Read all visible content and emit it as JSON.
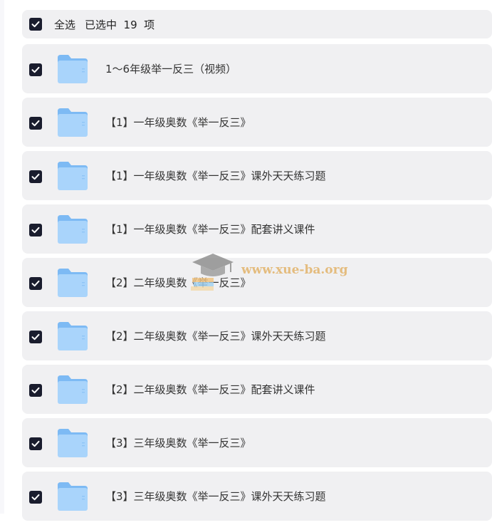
{
  "header": {
    "select_all_label": "全选",
    "selected_count_text": "已选中  19  项"
  },
  "items": [
    {
      "name": "1～6年级举一反三（视频）",
      "checked": true,
      "icon": "folder-icon"
    },
    {
      "name": "【1】一年级奥数《举一反三》",
      "checked": true,
      "icon": "folder-icon"
    },
    {
      "name": "【1】一年级奥数《举一反三》课外天天练习题",
      "checked": true,
      "icon": "folder-icon"
    },
    {
      "name": "【1】一年级奥数《举一反三》配套讲义课件",
      "checked": true,
      "icon": "folder-icon"
    },
    {
      "name": "【2】二年级奥数《举一反三》",
      "checked": true,
      "icon": "folder-icon"
    },
    {
      "name": "【2】二年级奥数《举一反三》课外天天练习题",
      "checked": true,
      "icon": "folder-icon"
    },
    {
      "name": "【2】二年级奥数《举一反三》配套讲义课件",
      "checked": true,
      "icon": "folder-icon"
    },
    {
      "name": "【3】三年级奥数《举一反三》",
      "checked": true,
      "icon": "folder-icon"
    },
    {
      "name": "【3】三年级奥数《举一反三》课外天天练习题",
      "checked": true,
      "icon": "folder-icon"
    }
  ],
  "watermark": {
    "text": "www.xue-ba.org"
  },
  "colors": {
    "row_background": "#f0f0f2",
    "checkbox_fill": "#1a1d2e",
    "folder_light": "#a9d4fb",
    "folder_dark": "#7dbaf4",
    "watermark_text": "#e2b36a"
  }
}
